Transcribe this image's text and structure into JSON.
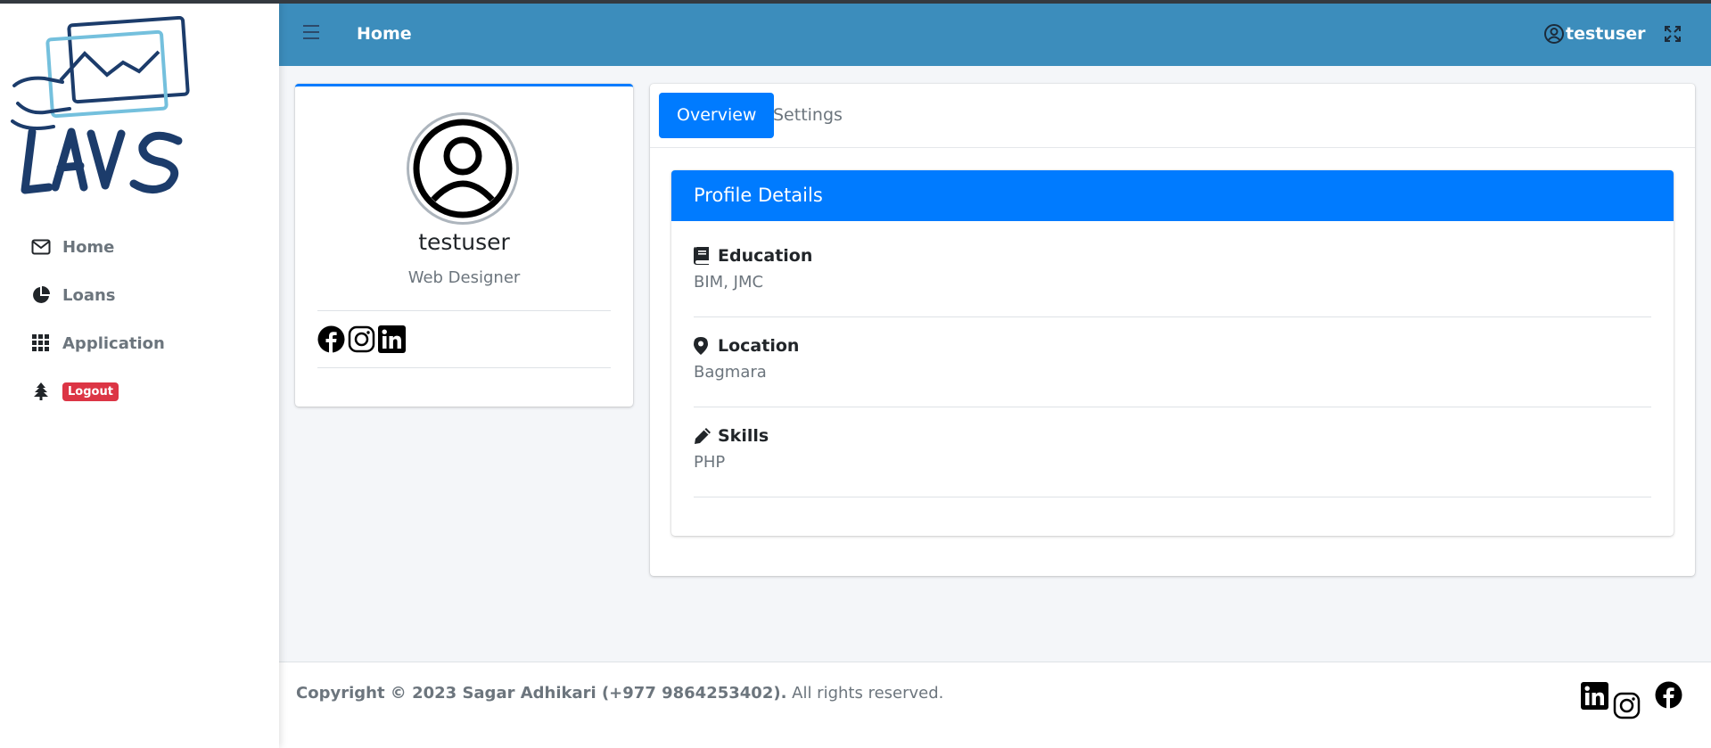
{
  "brand": {
    "name": "LAVS"
  },
  "sidebar": {
    "items": [
      {
        "label": "Home",
        "icon": "envelope-icon"
      },
      {
        "label": "Loans",
        "icon": "chart-pie-icon"
      },
      {
        "label": "Application",
        "icon": "grid-icon"
      },
      {
        "label": "Logout",
        "icon": "tree-icon",
        "badge_color": "#dc3545"
      }
    ]
  },
  "header": {
    "title": "Home",
    "username": "testuser",
    "color": "#3c8dbc"
  },
  "profile": {
    "name": "testuser",
    "role": "Web Designer",
    "socials": [
      "facebook-icon",
      "instagram-icon",
      "linkedin-icon"
    ]
  },
  "tabs": [
    {
      "label": "Overview",
      "active": true
    },
    {
      "label": "Settings",
      "active": false
    }
  ],
  "details": {
    "heading": "Profile Details",
    "items": [
      {
        "title": "Education",
        "value": "BIM, JMC",
        "icon": "book-icon"
      },
      {
        "title": "Location",
        "value": "Bagmara",
        "icon": "map-pin-icon"
      },
      {
        "title": "Skills",
        "value": "PHP",
        "icon": "pencil-icon"
      }
    ]
  },
  "footer": {
    "copyright": "Copyright © 2023 Sagar Adhikari (+977 9864253402).",
    "rights": " All rights reserved.",
    "icons": [
      "linkedin-icon",
      "instagram-icon",
      "facebook-icon"
    ]
  },
  "colors": {
    "primary": "#007bff",
    "danger": "#dc3545"
  }
}
